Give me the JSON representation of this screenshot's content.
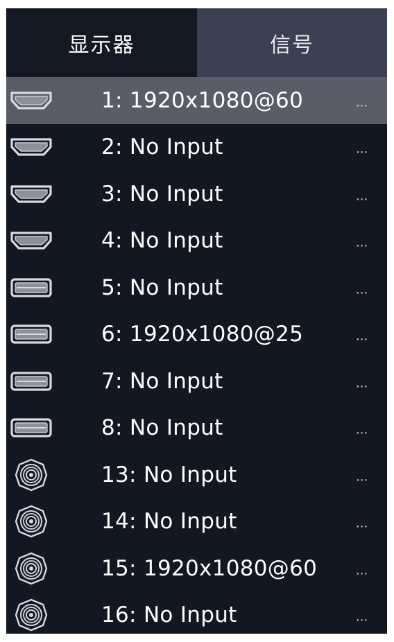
{
  "tabs": {
    "display_label": "显示器",
    "signal_label": "信号"
  },
  "signals": [
    {
      "label": "1: 1920x1080@60",
      "icon": "hdmi-port-icon",
      "more": "...",
      "selected": true
    },
    {
      "label": "2: No Input",
      "icon": "hdmi-port-icon",
      "more": "..."
    },
    {
      "label": "3: No Input",
      "icon": "hdmi-port-icon",
      "more": "..."
    },
    {
      "label": "4: No Input",
      "icon": "hdmi-port-icon",
      "more": "..."
    },
    {
      "label": "5: No Input",
      "icon": "displayport-port-icon",
      "more": "..."
    },
    {
      "label": "6: 1920x1080@25",
      "icon": "displayport-port-icon",
      "more": "..."
    },
    {
      "label": "7: No Input",
      "icon": "displayport-port-icon",
      "more": "..."
    },
    {
      "label": "8: No Input",
      "icon": "displayport-port-icon",
      "more": "..."
    },
    {
      "label": "13: No Input",
      "icon": "sdi-bnc-port-icon",
      "more": "..."
    },
    {
      "label": "14: No Input",
      "icon": "sdi-bnc-port-icon",
      "more": "..."
    },
    {
      "label": "15: 1920x1080@60",
      "icon": "sdi-bnc-port-icon",
      "more": "..."
    },
    {
      "label": "16: No Input",
      "icon": "sdi-bnc-port-icon",
      "more": "..."
    }
  ],
  "colors": {
    "panel_bg": "#131722",
    "tab_active_bg": "#3a3f52",
    "selected_row_bg": "#5a5d67",
    "text": "#ffffff"
  }
}
